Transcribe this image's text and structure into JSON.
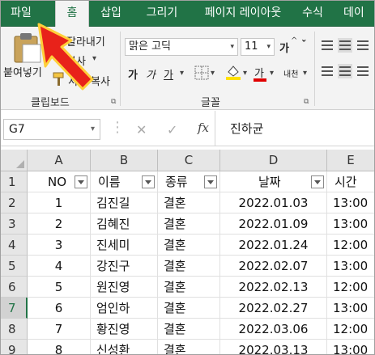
{
  "ribbon_tabs": [
    "파일",
    "홈",
    "삽입",
    "그리기",
    "페이지 레이아웃",
    "수식",
    "데이"
  ],
  "clipboard": {
    "paste_label": "붙여넣기",
    "cut_label": "잘라내기",
    "copy_label": "복사",
    "format_painter_label": "서식 복사",
    "group_label": "클립보드"
  },
  "font": {
    "font_name": "맑은 고딕",
    "font_size": "11",
    "bold": "가",
    "italic": "가",
    "underline": "가",
    "grow": "가",
    "text_color_icon": "가",
    "phonetic": "내천",
    "group_label": "글꼴"
  },
  "formula_bar": {
    "name_box": "G7",
    "fx_label": "fx",
    "content": "진하균"
  },
  "columns": [
    "A",
    "B",
    "C",
    "D",
    "E"
  ],
  "rows": [
    {
      "num": "1",
      "cells": [
        "NO",
        "이름",
        "종류",
        "날짜",
        "시간"
      ]
    },
    {
      "num": "2",
      "cells": [
        "1",
        "김진길",
        "결혼",
        "2022.01.03",
        "13:00"
      ]
    },
    {
      "num": "3",
      "cells": [
        "2",
        "김혜진",
        "결혼",
        "2022.01.09",
        "13:00"
      ]
    },
    {
      "num": "4",
      "cells": [
        "3",
        "진세미",
        "결혼",
        "2022.01.24",
        "12:00"
      ]
    },
    {
      "num": "5",
      "cells": [
        "4",
        "강진구",
        "결혼",
        "2022.02.07",
        "13:00"
      ]
    },
    {
      "num": "6",
      "cells": [
        "5",
        "원진영",
        "결혼",
        "2022.02.13",
        "12:00"
      ]
    },
    {
      "num": "7",
      "cells": [
        "6",
        "엄인하",
        "결혼",
        "2022.02.27",
        "13:00"
      ]
    },
    {
      "num": "8",
      "cells": [
        "7",
        "황진영",
        "결혼",
        "2022.03.06",
        "12:00"
      ]
    },
    {
      "num": "9",
      "cells": [
        "8",
        "신성환",
        "결혼",
        "2022.03.13",
        "13:00"
      ]
    }
  ],
  "colors": {
    "accent": "#217346",
    "highlight_arrow": "#e02010",
    "font_color": "#e00000",
    "fill_color": "#ffe000"
  }
}
